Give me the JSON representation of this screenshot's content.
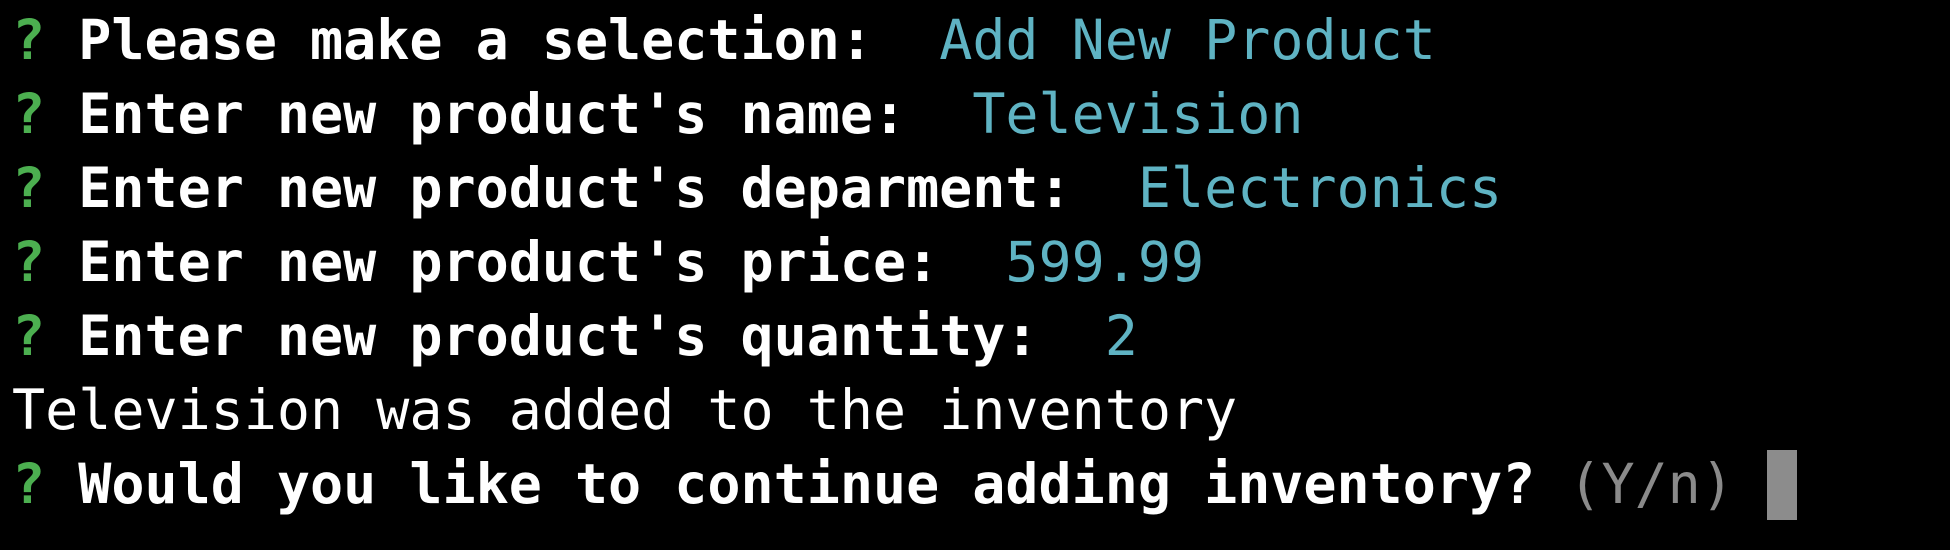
{
  "terminal": {
    "colors": {
      "background": "#000000",
      "question_mark": "#4caf50",
      "prompt_text": "#ffffff",
      "answer_text": "#5fb3c3",
      "hint_text": "#8a8a8a",
      "cursor": "#8c8c8c"
    },
    "continuation_marker": "[",
    "lines": [
      {
        "symbol": "?",
        "prompt": "Please make a selection:",
        "answer": "Add New Product"
      },
      {
        "symbol": "?",
        "prompt": "Enter new product's name:",
        "answer": "Television"
      },
      {
        "symbol": "?",
        "prompt": "Enter new product's deparment:",
        "answer": "Electronics"
      },
      {
        "symbol": "?",
        "prompt": "Enter new product's price:",
        "answer": "599.99"
      },
      {
        "symbol": "?",
        "prompt": "Enter new product's quantity:",
        "answer": "2"
      }
    ],
    "message": "Television was added to the inventory",
    "final_prompt": {
      "symbol": "?",
      "prompt": "Would you like to continue adding inventory?",
      "hint": "(Y/n)"
    }
  }
}
